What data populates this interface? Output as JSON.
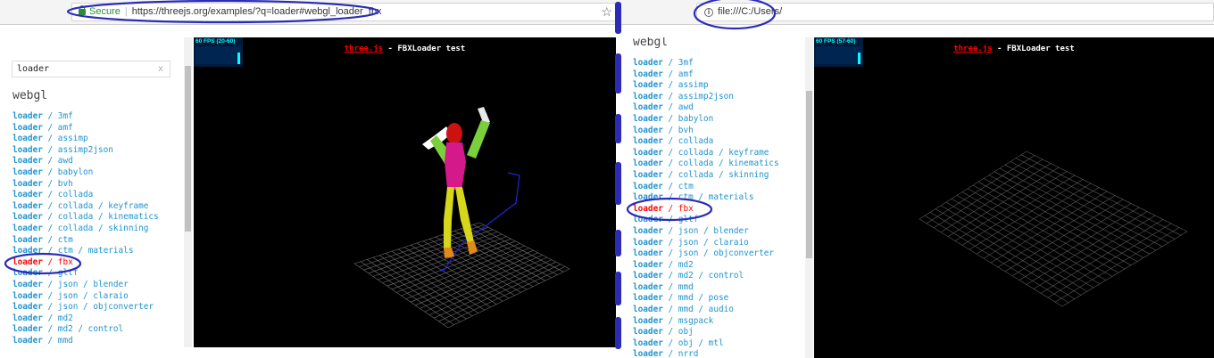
{
  "left": {
    "address": {
      "secure_label": "Secure",
      "separator": "|",
      "url": "https://threejs.org/examples/?q=loader#webgl_loader_fbx"
    },
    "sidebar": {
      "search_value": "loader",
      "clear_label": "x",
      "section_title": "webgl",
      "items": [
        {
          "kw": "loader",
          "rest": " / 3mf"
        },
        {
          "kw": "loader",
          "rest": " / amf"
        },
        {
          "kw": "loader",
          "rest": " / assimp"
        },
        {
          "kw": "loader",
          "rest": " / assimp2json"
        },
        {
          "kw": "loader",
          "rest": " / awd"
        },
        {
          "kw": "loader",
          "rest": " / babylon"
        },
        {
          "kw": "loader",
          "rest": " / bvh"
        },
        {
          "kw": "loader",
          "rest": " / collada"
        },
        {
          "kw": "loader",
          "rest": " / collada / keyframe"
        },
        {
          "kw": "loader",
          "rest": " / collada / kinematics"
        },
        {
          "kw": "loader",
          "rest": " / collada / skinning"
        },
        {
          "kw": "loader",
          "rest": " / ctm"
        },
        {
          "kw": "loader",
          "rest": " / ctm / materials"
        },
        {
          "kw": "loader",
          "rest": " / fbx",
          "selected": true
        },
        {
          "kw": "loader",
          "rest": " / gltf"
        },
        {
          "kw": "loader",
          "rest": " / json / blender"
        },
        {
          "kw": "loader",
          "rest": " / json / claraio"
        },
        {
          "kw": "loader",
          "rest": " / json / objconverter"
        },
        {
          "kw": "loader",
          "rest": " / md2"
        },
        {
          "kw": "loader",
          "rest": " / md2 / control"
        },
        {
          "kw": "loader",
          "rest": " / mmd"
        }
      ]
    },
    "viewport": {
      "fps": "60 FPS (20-60)",
      "brand": "three.js",
      "title_rest": " - FBXLoader test"
    }
  },
  "right": {
    "address": {
      "url": "file:///C:/Users/"
    },
    "sidebar": {
      "section_title": "webgl",
      "items": [
        {
          "kw": "loader",
          "rest": " / 3mf"
        },
        {
          "kw": "loader",
          "rest": " / amf"
        },
        {
          "kw": "loader",
          "rest": " / assimp"
        },
        {
          "kw": "loader",
          "rest": " / assimp2json"
        },
        {
          "kw": "loader",
          "rest": " / awd"
        },
        {
          "kw": "loader",
          "rest": " / babylon"
        },
        {
          "kw": "loader",
          "rest": " / bvh"
        },
        {
          "kw": "loader",
          "rest": " / collada"
        },
        {
          "kw": "loader",
          "rest": " / collada / keyframe"
        },
        {
          "kw": "loader",
          "rest": " / collada / kinematics"
        },
        {
          "kw": "loader",
          "rest": " / collada / skinning"
        },
        {
          "kw": "loader",
          "rest": " / ctm"
        },
        {
          "kw": "loader",
          "rest": " / ctm / materials"
        },
        {
          "kw": "loader",
          "rest": " / fbx",
          "selected": true
        },
        {
          "kw": "loader",
          "rest": " / gltf"
        },
        {
          "kw": "loader",
          "rest": " / json / blender"
        },
        {
          "kw": "loader",
          "rest": " / json / claraio"
        },
        {
          "kw": "loader",
          "rest": " / json / objconverter"
        },
        {
          "kw": "loader",
          "rest": " / md2"
        },
        {
          "kw": "loader",
          "rest": " / md2 / control"
        },
        {
          "kw": "loader",
          "rest": " / mmd"
        },
        {
          "kw": "loader",
          "rest": " / mmd / pose"
        },
        {
          "kw": "loader",
          "rest": " / mmd / audio"
        },
        {
          "kw": "loader",
          "rest": " / msgpack"
        },
        {
          "kw": "loader",
          "rest": " / obj"
        },
        {
          "kw": "loader",
          "rest": " / obj / mtl"
        },
        {
          "kw": "loader",
          "rest": " / nrrd"
        }
      ]
    },
    "viewport": {
      "fps": "60 FPS (57-60)",
      "brand": "three.js",
      "title_rest": " - FBXLoader test"
    }
  },
  "colors": {
    "link": "#2194ce",
    "selected": "#ff0000",
    "annotation": "#2b2bb8",
    "stats": "#00ffff"
  }
}
